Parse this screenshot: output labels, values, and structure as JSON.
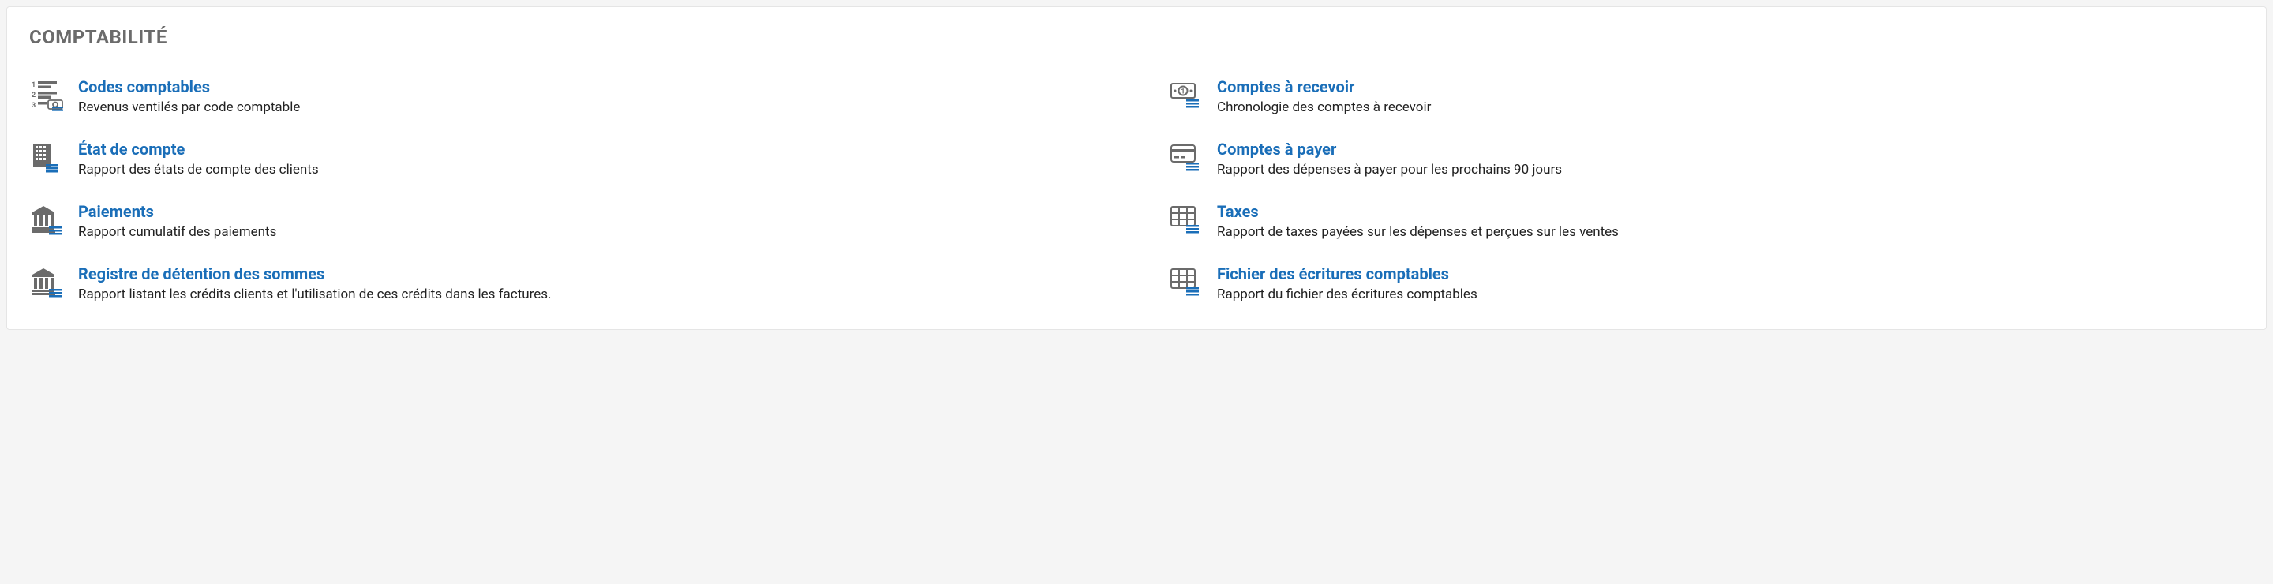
{
  "section_title": "COMPTABILITÉ",
  "items": [
    {
      "title": "Codes comptables",
      "desc": "Revenus ventilés par code comptable"
    },
    {
      "title": "Comptes à recevoir",
      "desc": "Chronologie des comptes à recevoir"
    },
    {
      "title": "État de compte",
      "desc": "Rapport des états de compte des clients"
    },
    {
      "title": "Comptes à payer",
      "desc": "Rapport des dépenses à payer pour les prochains 90 jours"
    },
    {
      "title": "Paiements",
      "desc": "Rapport cumulatif des paiements"
    },
    {
      "title": "Taxes",
      "desc": "Rapport de taxes payées sur les dépenses et perçues sur les ventes"
    },
    {
      "title": "Registre de détention des sommes",
      "desc": "Rapport listant les crédits clients et l'utilisation de ces crédits dans les factures."
    },
    {
      "title": "Fichier des écritures comptables",
      "desc": "Rapport du fichier des écritures comptables"
    }
  ]
}
